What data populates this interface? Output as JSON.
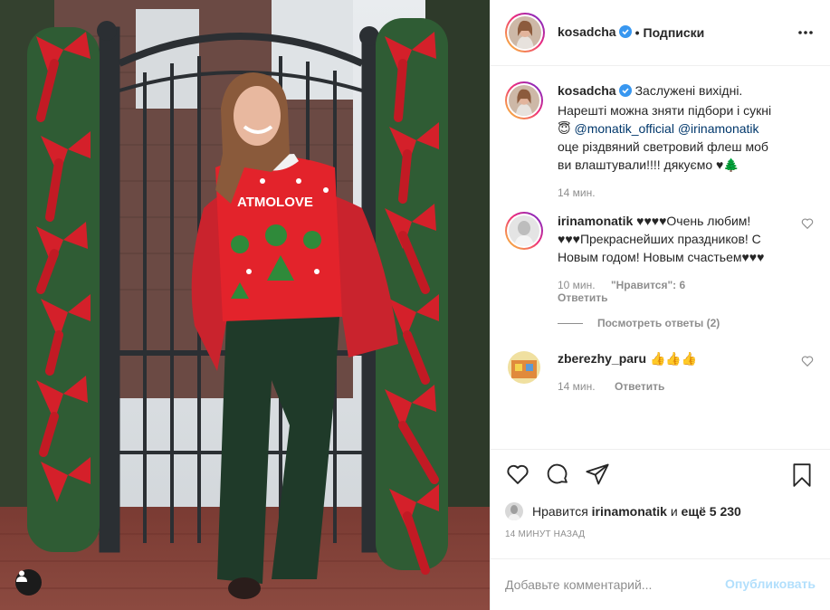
{
  "post": {
    "username": "kosadcha",
    "follow_status": "Подписки",
    "separator": "•"
  },
  "caption": {
    "username": "kosadcha",
    "text_1": "Заслужені вихідні. Нарешті можна зняти підбори і сукні 😇 ",
    "mention_1": "@monatik_official",
    "mention_2": "@irinamonatik",
    "text_2": " оце різдвяний светровий флеш моб ви влаштували!!!! дякуємо ♥🌲",
    "time": "14 мин."
  },
  "comments": [
    {
      "username": "irinamonatik",
      "text": "♥♥♥♥Очень любим! ♥♥♥Прекраснейших праздников! С Новым годом! Новым счастьем♥♥♥",
      "time": "10 мин.",
      "likes": "\"Нравится\": 6",
      "reply": "Ответить",
      "view_replies": "Посмотреть ответы (2)"
    },
    {
      "username": "zberezhy_paru",
      "text": "👍👍👍",
      "time": "14 мин.",
      "reply": "Ответить"
    }
  ],
  "likes": {
    "prefix": "Нравится",
    "user": "irinamonatik",
    "middle": "и",
    "count": "ещё 5 230"
  },
  "timestamp": "14 МИНУТ НАЗАД",
  "comment_box": {
    "placeholder": "Добавьте комментарий...",
    "publish": "Опубликовать"
  },
  "photo": {
    "sweater_text": "ATMOLOVE"
  },
  "colors": {
    "text": "#262626",
    "muted": "#8e8e8e",
    "mention": "#00376b",
    "publish_disabled": "#b2dffc",
    "verified": "#3897f0"
  },
  "icons": [
    "heart-icon",
    "comment-icon",
    "share-icon",
    "bookmark-icon",
    "more-icon",
    "verified-icon",
    "tag-user-icon"
  ]
}
